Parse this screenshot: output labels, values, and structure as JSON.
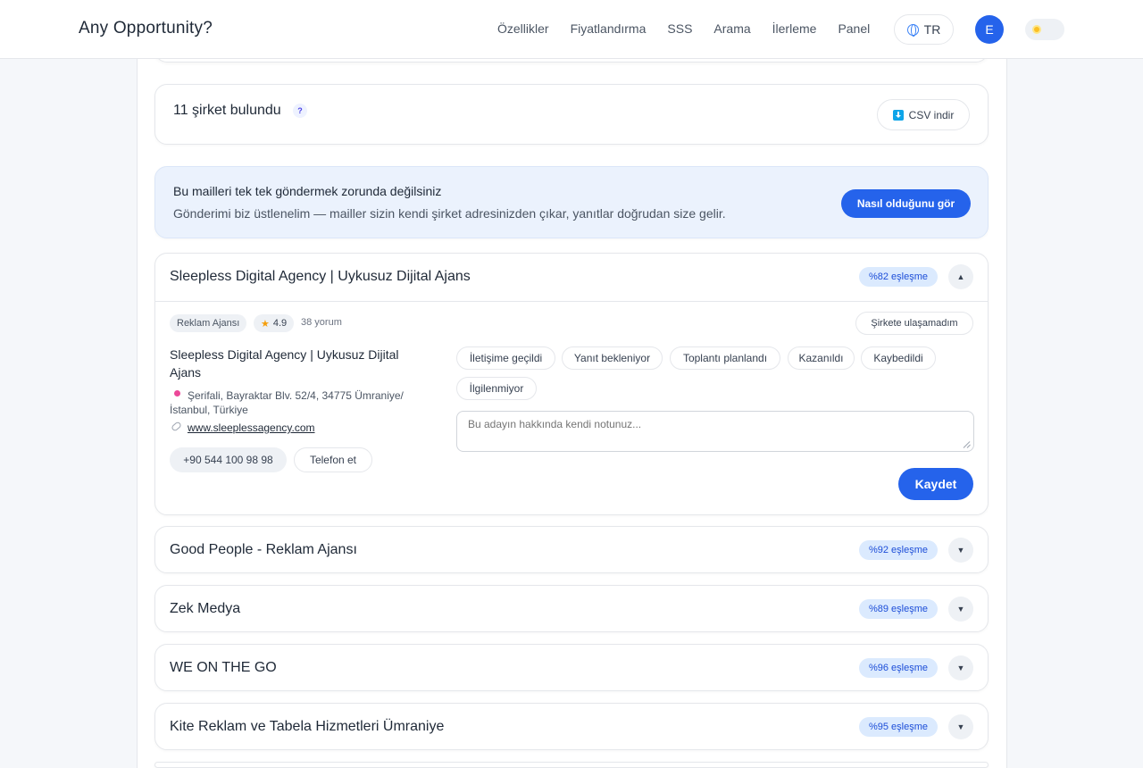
{
  "header": {
    "brand": "Any Opportunity?",
    "nav": [
      "Özellikler",
      "Fiyatlandırma",
      "SSS",
      "Arama",
      "İlerleme",
      "Panel"
    ],
    "language": "TR",
    "avatar_initial": "E",
    "accent_color": "#2563eb"
  },
  "results": {
    "count_text": "11 şirket bulundu",
    "help_symbol": "?",
    "csv_label": "CSV indir"
  },
  "promo": {
    "title": "Bu mailleri tek tek göndermek zorunda değilsiniz",
    "subtitle": "Gönderimi biz üstlenelim — mailler sizin kendi şirket adresinizden çıkar, yanıtlar doğrudan size gelir.",
    "button": "Nasıl olduğunu gör"
  },
  "expanded_company": {
    "name": "Sleepless Digital Agency | Uykusuz Dijital Ajans",
    "match": "%82 eşleşme",
    "chevron": "▲",
    "category": "Reklam Ajansı",
    "rating": "4.9",
    "reviews": "38 yorum",
    "unreachable_label": "Şirkete ulaşamadım",
    "detail_name": "Sleepless Digital Agency | Uykusuz Dijital Ajans",
    "address": "Şerifali, Bayraktar Blv. 52/4, 34775 Ümraniye/İstanbul, Türkiye",
    "website": "www.sleeplessagency.com",
    "phone": "+90 544 100 98 98",
    "call_label": "Telefon et",
    "statuses": [
      "İletişime geçildi",
      "Yanıt bekleniyor",
      "Toplantı planlandı",
      "Kazanıldı",
      "Kaybedildi",
      "İlgilenmiyor"
    ],
    "notes_placeholder": "Bu adayın hakkında kendi notunuz...",
    "save_label": "Kaydet"
  },
  "companies": [
    {
      "name": "Good People - Reklam Ajansı",
      "match": "%92 eşleşme",
      "chevron": "▼"
    },
    {
      "name": "Zek Medya",
      "match": "%89 eşleşme",
      "chevron": "▼"
    },
    {
      "name": "WE ON THE GO",
      "match": "%96 eşleşme",
      "chevron": "▼"
    },
    {
      "name": "Kite Reklam ve Tabela Hizmetleri Ümraniye",
      "match": "%95 eşleşme",
      "chevron": "▼"
    }
  ]
}
